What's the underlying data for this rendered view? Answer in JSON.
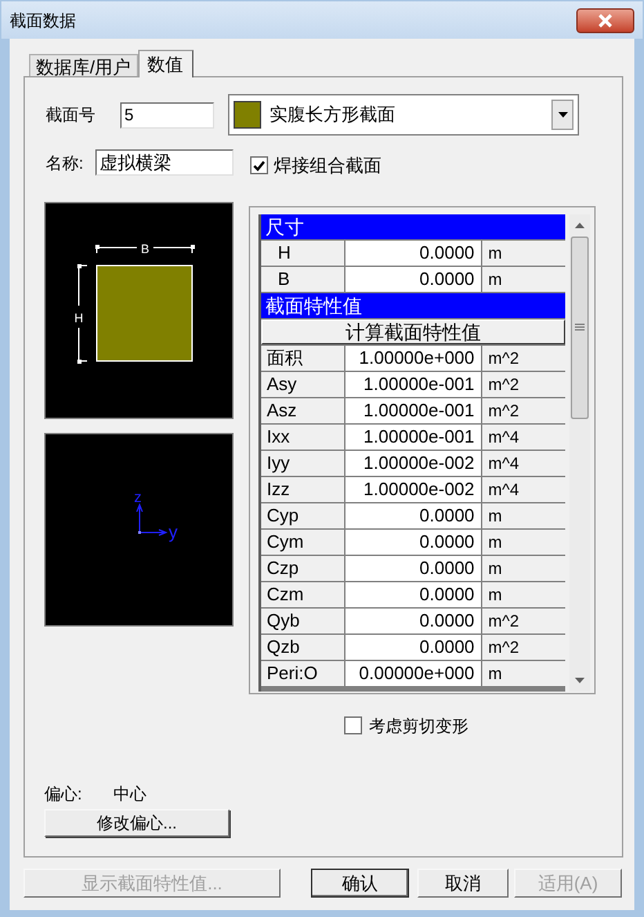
{
  "window": {
    "title": "截面数据"
  },
  "tabs": [
    {
      "label": "数据库/用户",
      "selected": false
    },
    {
      "label": "数值",
      "selected": true
    }
  ],
  "section_number": {
    "label": "截面号",
    "value": "5"
  },
  "section_type": {
    "value": "实腹长方形截面"
  },
  "name": {
    "label": "名称:",
    "value": "虚拟横梁"
  },
  "welded": {
    "label": "焊接组合截面",
    "checked": true
  },
  "section_preview": {
    "width_label": "B",
    "height_label": "H"
  },
  "axes_preview": {
    "z_label": "z",
    "y_label": "y"
  },
  "properties": [
    {
      "kind": "header",
      "label": "尺寸"
    },
    {
      "kind": "dimension",
      "name": "H",
      "value": "0.0000",
      "unit": "m"
    },
    {
      "kind": "dimension",
      "name": "B",
      "value": "0.0000",
      "unit": "m"
    },
    {
      "kind": "header",
      "label": "截面特性值"
    },
    {
      "kind": "button",
      "label": "计算截面特性值"
    },
    {
      "kind": "property",
      "name": "面积",
      "value": "1.00000e+000",
      "unit": "m^2"
    },
    {
      "kind": "property",
      "name": "Asy",
      "value": "1.00000e-001",
      "unit": "m^2"
    },
    {
      "kind": "property",
      "name": "Asz",
      "value": "1.00000e-001",
      "unit": "m^2"
    },
    {
      "kind": "property",
      "name": "Ixx",
      "value": "1.00000e-001",
      "unit": "m^4"
    },
    {
      "kind": "property",
      "name": "Iyy",
      "value": "1.00000e-002",
      "unit": "m^4"
    },
    {
      "kind": "property",
      "name": "Izz",
      "value": "1.00000e-002",
      "unit": "m^4"
    },
    {
      "kind": "property",
      "name": "Cyp",
      "value": "0.0000",
      "unit": "m"
    },
    {
      "kind": "property",
      "name": "Cym",
      "value": "0.0000",
      "unit": "m"
    },
    {
      "kind": "property",
      "name": "Czp",
      "value": "0.0000",
      "unit": "m"
    },
    {
      "kind": "property",
      "name": "Czm",
      "value": "0.0000",
      "unit": "m"
    },
    {
      "kind": "property",
      "name": "Qyb",
      "value": "0.0000",
      "unit": "m^2"
    },
    {
      "kind": "property",
      "name": "Qzb",
      "value": "0.0000",
      "unit": "m^2"
    },
    {
      "kind": "property",
      "name": "Peri:O",
      "value": "0.00000e+000",
      "unit": "m"
    }
  ],
  "shear_deformation": {
    "label": "考虑剪切变形",
    "checked": false
  },
  "offset": {
    "label": "偏心:",
    "value": "中心",
    "button": "修改偏心..."
  },
  "buttons": [
    {
      "label": "显示截面特性值...",
      "disabled": true,
      "default": false
    },
    {
      "label": "确认",
      "disabled": false,
      "default": true
    },
    {
      "label": "取消",
      "disabled": false,
      "default": false
    },
    {
      "label": "适用(A)",
      "disabled": true,
      "default": false
    }
  ]
}
